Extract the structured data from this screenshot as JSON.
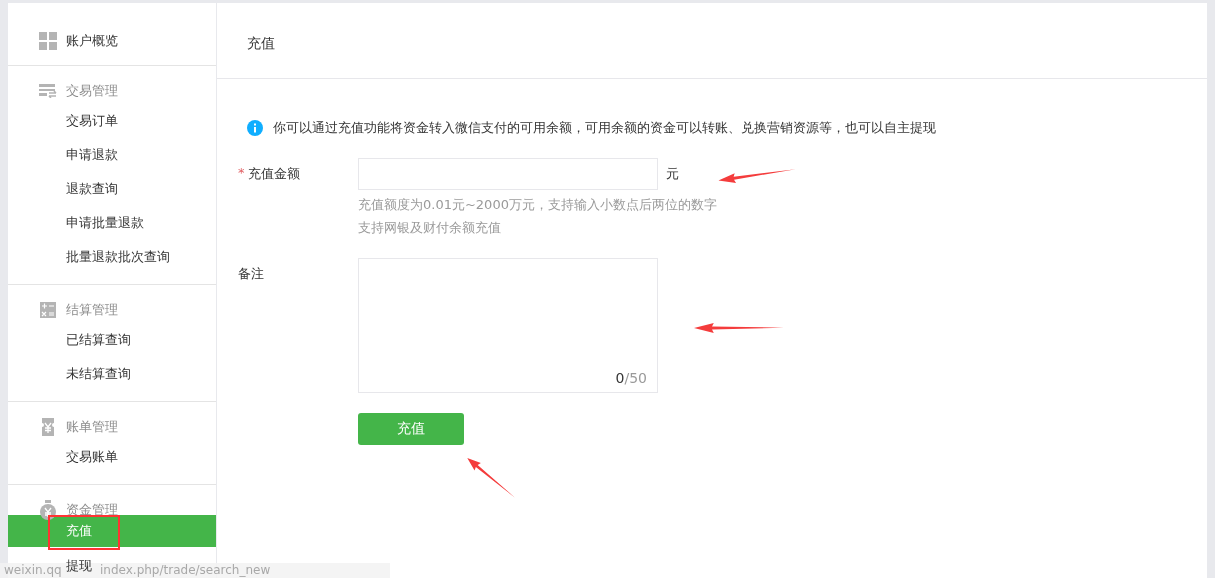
{
  "sidebar": {
    "items": [
      {
        "kind": "link",
        "label": "账户概览"
      },
      {
        "kind": "group",
        "label": "交易管理",
        "children": [
          {
            "label": "交易订单",
            "selected": false
          },
          {
            "label": "申请退款",
            "selected": false
          },
          {
            "label": "退款查询",
            "selected": false
          },
          {
            "label": "申请批量退款",
            "selected": false
          },
          {
            "label": "批量退款批次查询",
            "selected": false
          }
        ]
      },
      {
        "kind": "group",
        "label": "结算管理",
        "children": [
          {
            "label": "已结算查询",
            "selected": false
          },
          {
            "label": "未结算查询",
            "selected": false
          }
        ]
      },
      {
        "kind": "group",
        "label": "账单管理",
        "children": [
          {
            "label": "交易账单",
            "selected": false
          }
        ]
      },
      {
        "kind": "group",
        "label": "资金管理",
        "children": [
          {
            "label": "充值",
            "selected": true
          },
          {
            "label": "提现",
            "selected": false
          }
        ]
      }
    ]
  },
  "page": {
    "title": "充值"
  },
  "notice": "你可以通过充值功能将资金转入微信支付的可用余额，可用余额的资金可以转账、兑换营销资源等，也可以自主提现",
  "form": {
    "fields": [
      {
        "kind": "input",
        "label": "充值金额",
        "mark": "*",
        "unit": "元",
        "hints": [
          "充值额度为0.01元~2000万元，支持输入小数点后两位的数字",
          "支持网银及财付余额充值"
        ]
      },
      {
        "kind": "textarea",
        "label": "备注",
        "count": "0",
        "max": "/50"
      }
    ],
    "submit": "充值"
  },
  "annotations": [
    {
      "kind": "arrow"
    },
    {
      "kind": "arrow"
    },
    {
      "kind": "arrow"
    },
    {
      "kind": "box"
    }
  ],
  "status_bar": {
    "url_parts": [
      "weixin.qq",
      "index.php/trade/search_new"
    ]
  }
}
